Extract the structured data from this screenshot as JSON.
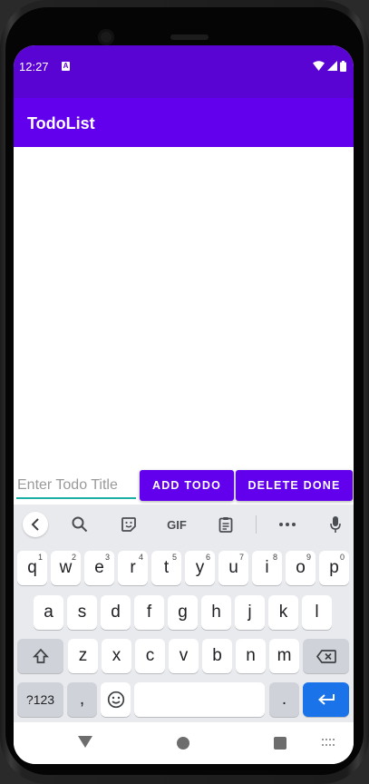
{
  "status": {
    "time": "12:27",
    "notif_icon": "A"
  },
  "app": {
    "title": "TodoList"
  },
  "form": {
    "placeholder": "Enter Todo Title",
    "value": "",
    "add_label": "ADD TODO",
    "delete_label": "DELETE DONE"
  },
  "keyboard": {
    "toolbar": {
      "gif_label": "GIF"
    },
    "row1": [
      {
        "k": "q",
        "h": "1"
      },
      {
        "k": "w",
        "h": "2"
      },
      {
        "k": "e",
        "h": "3"
      },
      {
        "k": "r",
        "h": "4"
      },
      {
        "k": "t",
        "h": "5"
      },
      {
        "k": "y",
        "h": "6"
      },
      {
        "k": "u",
        "h": "7"
      },
      {
        "k": "i",
        "h": "8"
      },
      {
        "k": "o",
        "h": "9"
      },
      {
        "k": "p",
        "h": "0"
      }
    ],
    "row2": [
      "a",
      "s",
      "d",
      "f",
      "g",
      "h",
      "j",
      "k",
      "l"
    ],
    "row3": [
      "z",
      "x",
      "c",
      "v",
      "b",
      "n",
      "m"
    ],
    "symbols_label": "?123",
    "comma_label": ",",
    "period_label": "."
  },
  "colors": {
    "status_bar": "#5a04d4",
    "app_bar": "#6200ee",
    "accent": "#1ab0a6",
    "enter_key": "#1a73e8"
  }
}
